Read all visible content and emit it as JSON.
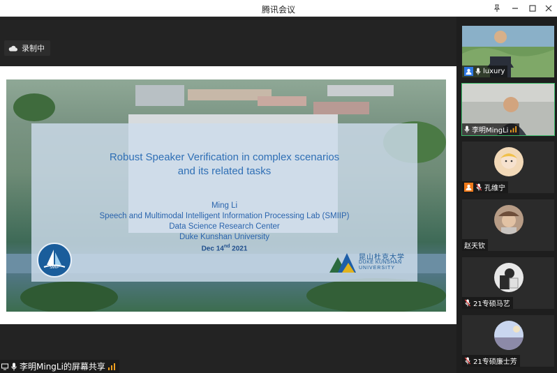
{
  "window": {
    "title": "腾讯会议"
  },
  "recording": {
    "label": "录制中"
  },
  "slide": {
    "title_line1": "Robust Speaker Verification in complex scenarios",
    "title_line2": "and its related tasks",
    "author": "Ming Li",
    "lab": "Speech and Multimodal Intelligent Information Processing Lab (SMIIP)",
    "center": "Data Science Research Center",
    "university": "Duke Kunshan University",
    "date_day": "Dec 14",
    "date_suffix": "nd",
    "date_year": "2021",
    "logo_left_text": "SMIIP",
    "logo_right_cn": "昆山杜克大学",
    "logo_right_en1": "DUKE KUNSHAN",
    "logo_right_en2": "UNIVERSITY"
  },
  "share_bar": {
    "label": "李明MingLi的屏幕共享"
  },
  "participants": [
    {
      "name": "luxury",
      "video": true,
      "badge": "user-icon"
    },
    {
      "name": "李明MingLi",
      "video": true,
      "active": true,
      "speaking": true
    },
    {
      "name": "孔维宁",
      "video": false,
      "muted": true,
      "badge": "user-icon"
    },
    {
      "name": "赵天钦",
      "video": false
    },
    {
      "name": "21专硕马艺",
      "video": false,
      "muted": true
    },
    {
      "name": "21专硕廉士芳",
      "video": false,
      "muted": true
    }
  ],
  "colors": {
    "accent_green": "#3dbd6b",
    "badge_orange": "#f07a1a",
    "badge_blue": "#2f7ae5",
    "slide_title": "#2f6fb5"
  }
}
